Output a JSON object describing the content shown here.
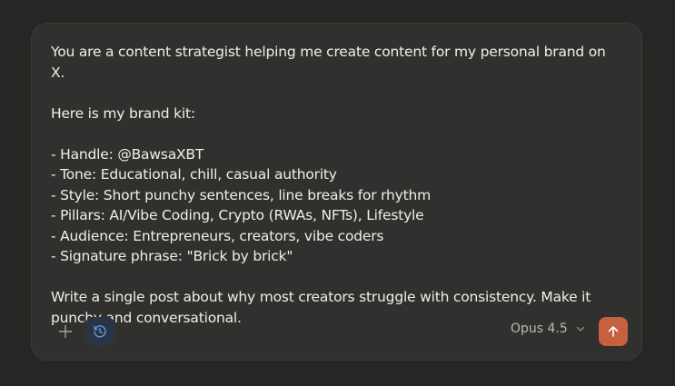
{
  "composer": {
    "intro": "You are a content strategist helping me create content for my personal brand on X.",
    "brand_kit_heading": "Here is my brand kit:",
    "brand_kit_items": [
      "- Handle: @BawsaXBT",
      "- Tone: Educational, chill, casual authority",
      "- Style: Short punchy sentences, line breaks for rhythm",
      "- Pillars: AI/Vibe Coding, Crypto (RWAs, NFTs), Lifestyle",
      "- Audience: Entrepreneurs, creators, vibe coders",
      "- Signature phrase: \"Brick by brick\""
    ],
    "instruction": "Write a single post about why most creators struggle with consistency. Make it punchy and conversational."
  },
  "toolbar": {
    "add_icon": "plus-icon",
    "history_icon": "history-icon",
    "model_label": "Opus 4.5",
    "model_dropdown_icon": "chevron-down-icon",
    "send_icon": "arrow-up-icon"
  },
  "colors": {
    "background": "#262624",
    "composer_bg": "#30302e",
    "text": "#f0eee6",
    "accent_send": "#c6613f",
    "history_active": "#5b9ae0"
  }
}
